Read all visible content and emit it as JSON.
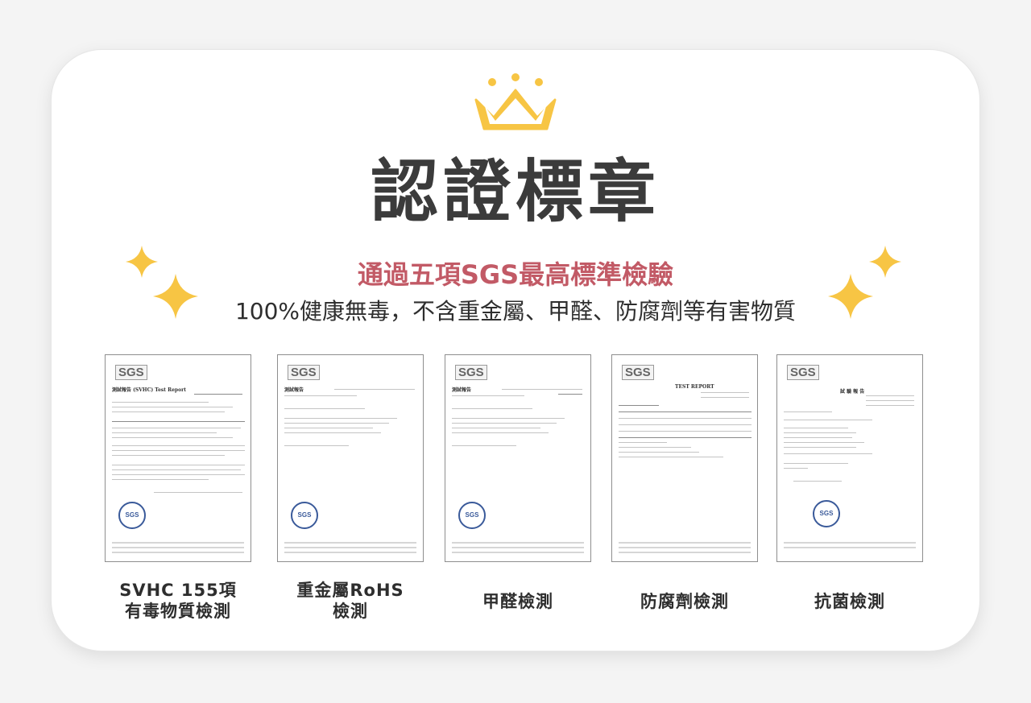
{
  "header": {
    "title": "認證標章",
    "subtitle": "通過五項SGS最高標準檢驗",
    "description": "100%健康無毒，不含重金屬、甲醛、防腐劑等有害物質"
  },
  "colors": {
    "title": "#3b3b3b",
    "subtitle": "#c25a66",
    "crown": "#f7c544",
    "sparkle": "#f7c544"
  },
  "certificates": [
    {
      "logo": "SGS",
      "heading": "測試報告 (SVHC)  Test Report",
      "label_lines": [
        "SVHC 155項",
        "有毒物質檢測"
      ]
    },
    {
      "logo": "SGS",
      "heading": "測試報告",
      "label_lines": [
        "重金屬RoHS",
        "檢測"
      ]
    },
    {
      "logo": "SGS",
      "heading": "測試報告",
      "label_lines": [
        "甲醛檢測"
      ]
    },
    {
      "logo": "SGS",
      "heading": "TEST REPORT",
      "label_lines": [
        "防腐劑檢測"
      ]
    },
    {
      "logo": "SGS",
      "heading": "試 驗 報 告",
      "label_lines": [
        "抗菌檢測"
      ]
    }
  ],
  "icons": [
    "crown-icon",
    "sparkle-icon"
  ]
}
